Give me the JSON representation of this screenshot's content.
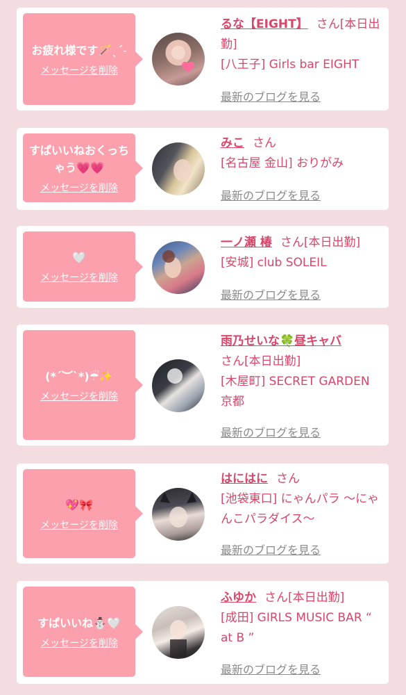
{
  "delete_label": "メッセージを削除",
  "blog_label": "最新のブログを見る",
  "honorific": "さん",
  "colors": {
    "page_background": "#f4dde0",
    "card_background": "#ffffff",
    "bubble_pink": "#fca0ad",
    "name_pink": "#d9466a",
    "link_gray": "#8a8a8a"
  },
  "cards": [
    {
      "message": "お疲れ様です🪄ˎˊ˗",
      "name": "るな【EIGHT】",
      "status": "[本日出勤]",
      "shop": "[八王子] Girls bar EIGHT",
      "avatar_icon": "avatar-photo-icon"
    },
    {
      "message": "すぱいいねおくっちゃう💗💗",
      "name": "みこ",
      "status": "",
      "shop": "[名古屋 金山] おりがみ",
      "avatar_icon": "avatar-photo-icon"
    },
    {
      "message": "🤍",
      "name": "一ノ瀬 椿",
      "status": "[本日出勤]",
      "shop": "[安城] club SOLEIL",
      "avatar_icon": "avatar-photo-icon"
    },
    {
      "message": "(*´︶`*)☔✨",
      "name": "雨乃せいな🍀昼キャバ",
      "status": "[本日出勤]",
      "shop": "[木屋町] SECRET GARDEN 京都",
      "avatar_icon": "avatar-photo-icon"
    },
    {
      "message": "💖🎀",
      "name": "はにはに",
      "status": "",
      "shop": "[池袋東口] にゃんパラ ～にゃんこパラダイス～",
      "avatar_icon": "avatar-photo-icon"
    },
    {
      "message": "すぱいいね⛄🤍",
      "name": "ふゆか",
      "status": "[本日出勤]",
      "shop": "[成田] GIRLS MUSIC BAR “ at B ”",
      "avatar_icon": "avatar-photo-icon"
    }
  ]
}
